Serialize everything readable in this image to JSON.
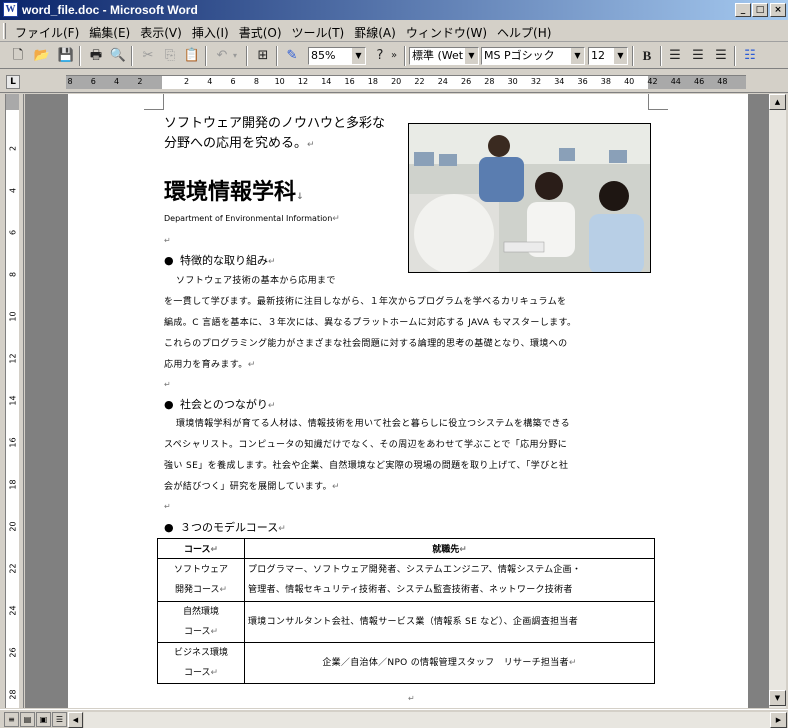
{
  "window": {
    "title": "word_file.doc - Microsoft Word",
    "app_icon": "W",
    "controls": [
      "_",
      "□",
      "×"
    ]
  },
  "menu": [
    "ファイル(F)",
    "編集(E)",
    "表示(V)",
    "挿入(I)",
    "書式(O)",
    "ツール(T)",
    "罫線(A)",
    "ウィンドウ(W)",
    "ヘルプ(H)"
  ],
  "toolbar": {
    "zoom": "85%",
    "style": "標準 (Wet",
    "font": "MS Pゴシック",
    "size": "12",
    "bold": "B",
    "help": "?",
    "more": "»"
  },
  "ruler": {
    "tab_selector": "L",
    "h_numbers": [
      "8",
      "6",
      "4",
      "2",
      "",
      "2",
      "4",
      "6",
      "8",
      "10",
      "12",
      "14",
      "16",
      "18",
      "20",
      "22",
      "24",
      "26",
      "28",
      "30",
      "32",
      "34",
      "36",
      "38",
      "40",
      "42",
      "44",
      "46",
      "48"
    ],
    "v_numbers": [
      "2",
      "4",
      "6",
      "8",
      "10",
      "12",
      "14",
      "16",
      "18",
      "20",
      "22",
      "24",
      "26",
      "28"
    ]
  },
  "document": {
    "intro_line1": "ソフトウェア開発のノウハウと多彩な",
    "intro_line2": "分野への応用を究める。",
    "heading": "環境情報学科",
    "heading_en": "Department of Environmental Information",
    "section1": {
      "title": "特徴的な取り組み",
      "lines": [
        "ソフトウェア技術の基本から応用まで",
        "を一貫して学びます。最新技術に注目しながら、１年次からプログラムを学べるカリキュラムを",
        "編成。C 言語を基本に、３年次には、異なるプラットホームに対応する JAVA もマスターします。",
        "これらのプログラミング能力がさまざまな社会問題に対する論理的思考の基礎となり、環境への",
        "応用力を育みます。"
      ]
    },
    "section2": {
      "title": "社会とのつながり",
      "lines": [
        "環境情報学科が育てる人材は、情報技術を用いて社会と暮らしに役立つシステムを構築できる",
        "スペシャリスト。コンピュータの知識だけでなく、その周辺をあわせて学ぶことで「応用分野に",
        "強い SE」を養成します。社会や企業、自然環境など実際の現場の問題を取り上げて、「学びと社",
        "会が結びつく」研究を展開しています。"
      ]
    },
    "section3": {
      "title": "３つのモデルコース",
      "table": {
        "headers": [
          "コース",
          "就職先"
        ],
        "rows": [
          {
            "course": [
              "ソフトウェア",
              "開発コース"
            ],
            "jobs": [
              "プログラマー、ソフトウェア開発者、システムエンジニア、情報システム企画・",
              "管理者、情報セキュリティ技術者、システム監査技術者、ネットワーク技術者"
            ]
          },
          {
            "course": [
              "自然環境",
              "コース"
            ],
            "jobs": [
              "環境コンサルタント会社、情報サービス業（情報系 SE など）、企画調査担当者"
            ]
          },
          {
            "course": [
              "ビジネス環境",
              "コース"
            ],
            "jobs": [
              "企業／自治体／NPO の情報管理スタッフ　リサーチ担当者"
            ]
          }
        ]
      }
    }
  }
}
